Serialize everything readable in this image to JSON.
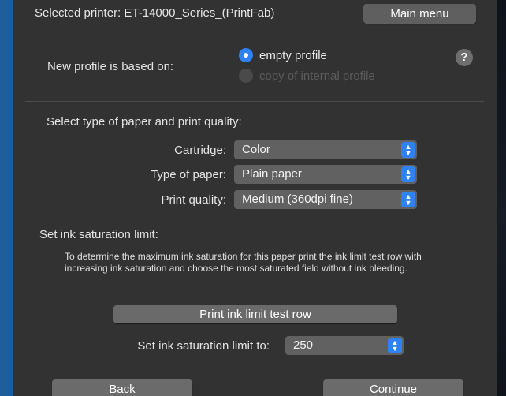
{
  "header": {
    "selected_printer": "Selected printer: ET-14000_Series_(PrintFab)",
    "main_menu_label": "Main menu"
  },
  "profile": {
    "based_on_label": "New profile is based on:",
    "options": [
      {
        "label": "empty profile",
        "selected": true,
        "enabled": true
      },
      {
        "label": "copy of internal profile",
        "selected": false,
        "enabled": false
      }
    ],
    "help_label": "?"
  },
  "paper": {
    "section_title": "Select type of paper and print quality:",
    "cartridge_label": "Cartridge:",
    "cartridge_value": "Color",
    "paper_type_label": "Type of paper:",
    "paper_type_value": "Plain paper",
    "quality_label": "Print quality:",
    "quality_value": "Medium (360dpi fine)"
  },
  "ink": {
    "section_title": "Set ink saturation limit:",
    "description": "To determine the maximum ink saturation for this paper print the ink limit test row with increasing ink saturation and choose the most saturated field without ink bleeding.",
    "test_button_label": "Print ink limit test row",
    "limit_label": "Set ink saturation limit to:",
    "limit_value": "250"
  },
  "footer": {
    "back_label": "Back",
    "continue_label": "Continue"
  },
  "colors": {
    "window_bg": "#323232",
    "accent": "#2f82f5",
    "control_bg": "#616161",
    "frame": "#1e5e9a"
  },
  "icons": {
    "radio_selected": "radio-selected-icon",
    "help": "question-mark-icon",
    "select_arrows": "up-down-chevron-icon"
  }
}
